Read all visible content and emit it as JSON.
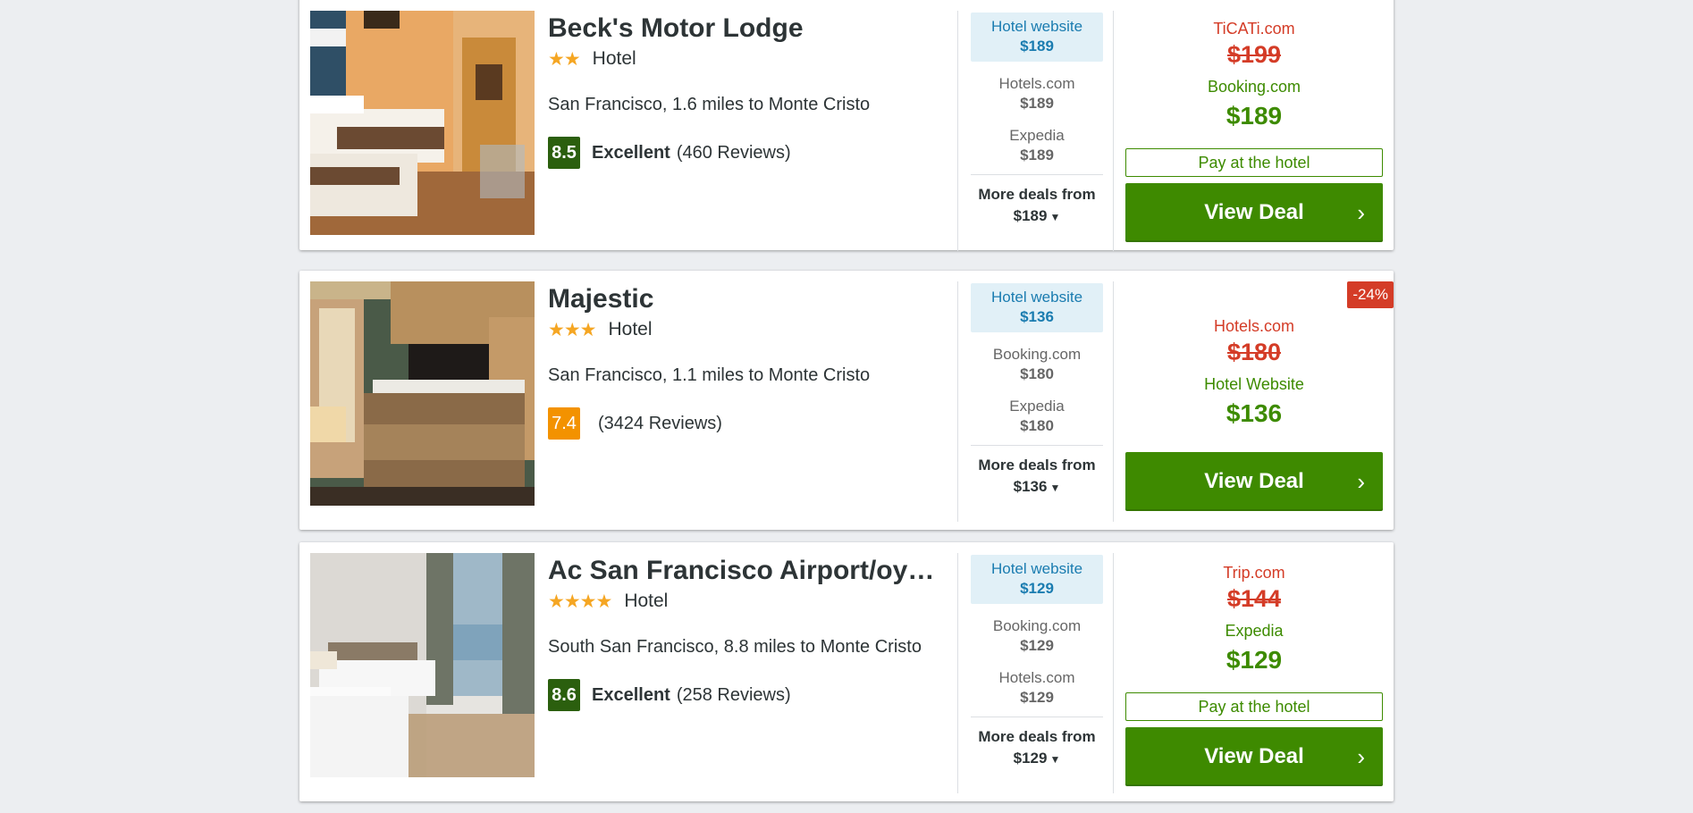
{
  "colors": {
    "background": "#eceef1",
    "card": "#ffffff",
    "accent_green": "#3e8a00",
    "strike_red": "#d43c27",
    "star": "#f5a623",
    "hotel_site_blue": "#1a7cb0"
  },
  "hotels": [
    {
      "name": "Beck's Motor Lodge",
      "stars": "★★",
      "type": "Hotel",
      "location": "San Francisco, 1.6 miles to Monte Cristo",
      "score": "8.5",
      "rating_label": "Excellent",
      "reviews": "(460 Reviews)",
      "deal_top": {
        "site": "Hotel website",
        "price": "$189"
      },
      "deals": [
        {
          "site": "Hotels.com",
          "price": "$189"
        },
        {
          "site": "Expedia",
          "price": "$189"
        }
      ],
      "more_label": "More deals from",
      "more_price": "$189",
      "old_site": "TiCATi.com",
      "old_price": "$199",
      "new_site": "Booking.com",
      "new_price": "$189",
      "pay_label": "Pay at the hotel",
      "button_label": "View Deal"
    },
    {
      "name": "Majestic",
      "stars": "★★★",
      "type": "Hotel",
      "location": "San Francisco, 1.1 miles to Monte Cristo",
      "score": "7.4",
      "rating_label": "",
      "reviews": "(3424 Reviews)",
      "deal_top": {
        "site": "Hotel website",
        "price": "$136"
      },
      "deals": [
        {
          "site": "Booking.com",
          "price": "$180"
        },
        {
          "site": "Expedia",
          "price": "$180"
        }
      ],
      "more_label": "More deals from",
      "more_price": "$136",
      "badge": "-24%",
      "old_site": "Hotels.com",
      "old_price": "$180",
      "new_site": "Hotel Website",
      "new_price": "$136",
      "button_label": "View Deal"
    },
    {
      "name": "Ac San Francisco Airport/oyster Point Waterfront",
      "stars": "★★★★",
      "type": "Hotel",
      "location": "South San Francisco, 8.8 miles to Monte Cristo",
      "score": "8.6",
      "rating_label": "Excellent",
      "reviews": "(258 Reviews)",
      "deal_top": {
        "site": "Hotel website",
        "price": "$129"
      },
      "deals": [
        {
          "site": "Booking.com",
          "price": "$129"
        },
        {
          "site": "Hotels.com",
          "price": "$129"
        }
      ],
      "more_label": "More deals from",
      "more_price": "$129",
      "old_site": "Trip.com",
      "old_price": "$144",
      "new_site": "Expedia",
      "new_price": "$129",
      "pay_label": "Pay at the hotel",
      "button_label": "View Deal"
    }
  ]
}
